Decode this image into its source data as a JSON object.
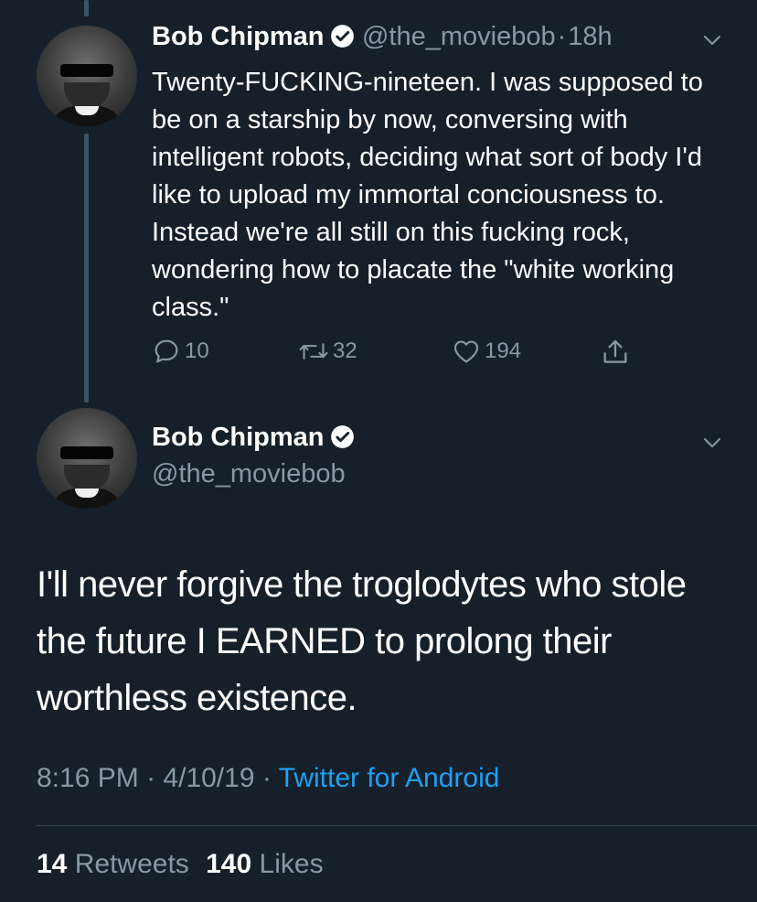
{
  "tweet1": {
    "name": "Bob Chipman",
    "handle": "@the_moviebob",
    "separator": "·",
    "time": "18h",
    "text": "Twenty-FUCKING-nineteen. I was supposed to be on a starship by now, conversing with intelligent robots, deciding what sort of body I'd like to upload my immortal conciousness to. Instead we're all still on this fucking rock, wondering how to placate the \"white working class.\"",
    "replies": "10",
    "retweets": "32",
    "likes": "194"
  },
  "tweet2": {
    "name": "Bob Chipman",
    "handle": "@the_moviebob",
    "text": "I'll never forgive the troglodytes who stole the future I EARNED to prolong their worthless existence.",
    "time": "8:16 PM",
    "sep1": "·",
    "date": "4/10/19",
    "sep2": "·",
    "source": "Twitter for Android",
    "retweet_count": "14",
    "retweet_label": "Retweets",
    "like_count": "140",
    "like_label": "Likes"
  },
  "colors": {
    "background": "#15202b",
    "muted": "#8899a6",
    "link": "#1da1f2",
    "thread_line": "#3d5466"
  }
}
